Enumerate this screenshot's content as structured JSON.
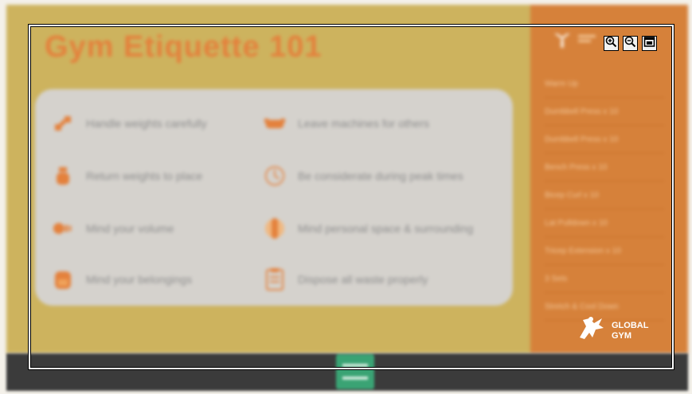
{
  "poster": {
    "title": "Gym Etiquette 101",
    "rules": [
      {
        "text": "Handle weights carefully",
        "icon": "dumbbell-icon"
      },
      {
        "text": "Leave machines for others",
        "icon": "machine-icon"
      },
      {
        "text": "Return weights to place",
        "icon": "kettlebell-icon"
      },
      {
        "text": "Be considerate during peak times",
        "icon": "clock-icon"
      },
      {
        "text": "Mind your volume",
        "icon": "speaker-icon"
      },
      {
        "text": "Mind personal space & surrounding",
        "icon": "person-icon"
      },
      {
        "text": "Mind your belongings",
        "icon": "backpack-icon"
      },
      {
        "text": "Dispose all waste properly",
        "icon": "clipboard-icon"
      }
    ]
  },
  "sidebar": {
    "items": [
      "Warm Up",
      "Dumbbell Press x 10",
      "Dumbbell Press x 10",
      "Bench Press x 10",
      "Bicep Curl x 10",
      "Lat Pulldown x 10",
      "Tricep Extension x 10",
      "3 Sets",
      "Stretch & Cool Down"
    ],
    "brand_line1": "GLOBAL",
    "brand_line2": "GYM"
  },
  "toolbar": {
    "zoom_in": "zoom-in-icon",
    "zoom_out": "zoom-out-icon",
    "open": "open-window-icon"
  },
  "colors": {
    "poster_bg": "#cdb35e",
    "accent": "#e4813c",
    "sidebar_bg": "#d6813a",
    "card_bg": "#d5d2cd",
    "bottom_bar": "#3b3b3b",
    "handle": "#3aa374"
  }
}
